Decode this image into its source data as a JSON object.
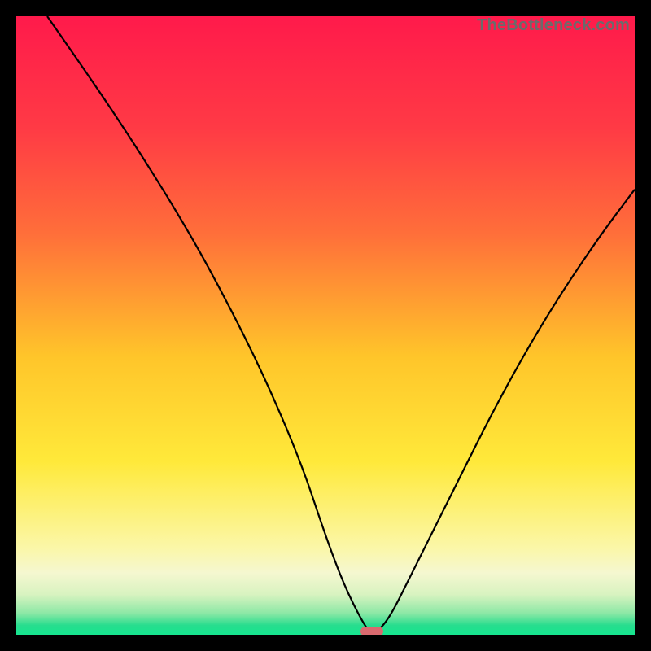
{
  "watermark": "TheBottleneck.com",
  "chart_data": {
    "type": "line",
    "title": "",
    "xlabel": "",
    "ylabel": "",
    "xlim": [
      0,
      100
    ],
    "ylim": [
      0,
      100
    ],
    "x": [
      5,
      12,
      20,
      28,
      34,
      40,
      46,
      50,
      53,
      56,
      57.5,
      60,
      64,
      70,
      78,
      86,
      94,
      100
    ],
    "values": [
      100,
      90,
      78,
      65,
      54,
      42,
      28,
      16,
      8,
      2,
      0,
      2,
      10,
      22,
      38,
      52,
      64,
      72
    ],
    "gradient_stops": [
      {
        "pos": 0.0,
        "color": "#ff1a4b"
      },
      {
        "pos": 0.18,
        "color": "#ff3a45"
      },
      {
        "pos": 0.35,
        "color": "#ff6e3a"
      },
      {
        "pos": 0.55,
        "color": "#ffc52a"
      },
      {
        "pos": 0.72,
        "color": "#ffe93a"
      },
      {
        "pos": 0.86,
        "color": "#fbf7a8"
      },
      {
        "pos": 0.9,
        "color": "#f5f7d0"
      },
      {
        "pos": 0.935,
        "color": "#d8f3c0"
      },
      {
        "pos": 0.965,
        "color": "#8de8a6"
      },
      {
        "pos": 0.985,
        "color": "#27dd8e"
      },
      {
        "pos": 1.0,
        "color": "#16e58f"
      }
    ],
    "min_marker": {
      "x": 57.5,
      "y": 0,
      "color": "#d96a6f"
    }
  }
}
